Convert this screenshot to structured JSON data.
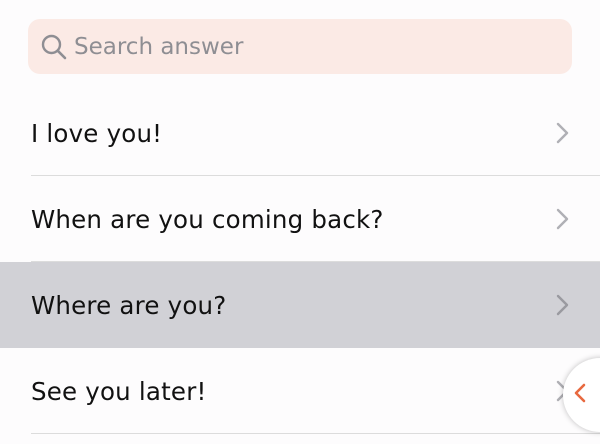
{
  "search": {
    "placeholder": "Search answer",
    "icon": "search-icon"
  },
  "answers": [
    {
      "label": "I love you!",
      "selected": false
    },
    {
      "label": "When are you coming back?",
      "selected": false
    },
    {
      "label": "Where are you?",
      "selected": true
    },
    {
      "label": "See you later!",
      "selected": false
    }
  ],
  "floating_tab": {
    "icon": "chevron-left-icon",
    "accent_color": "#e8693f"
  },
  "colors": {
    "search_background": "#fbeae5",
    "selected_row": "#d1d1d6",
    "chevron": "#b0b0b5"
  }
}
